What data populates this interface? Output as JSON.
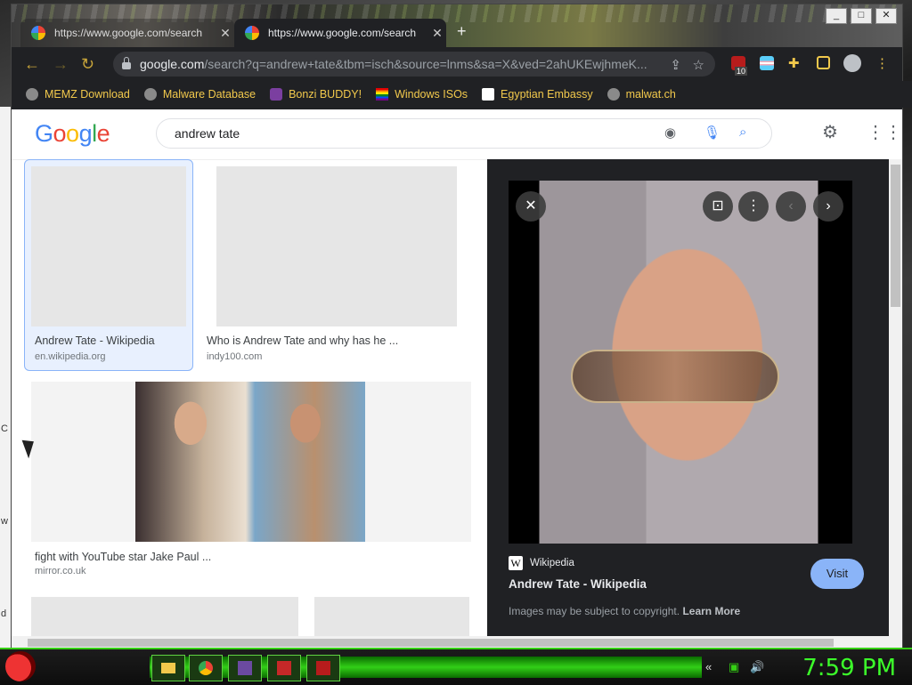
{
  "browser": {
    "tabs": [
      {
        "title": "https://www.google.com/search",
        "active": false
      },
      {
        "title": "https://www.google.com/search",
        "active": true
      }
    ],
    "new_tab": "+",
    "window_controls": [
      "_",
      "□",
      "✕"
    ],
    "url_domain": "google.com",
    "url_path": "/search?q=andrew+tate&tbm=isch&source=lnms&sa=X&ved=2ahUKEwjhmeK...",
    "extension_badge": "10"
  },
  "bookmarks": [
    {
      "label": "MEMZ Download"
    },
    {
      "label": "Malware Database"
    },
    {
      "label": "Bonzi BUDDY!"
    },
    {
      "label": "Windows ISOs"
    },
    {
      "label": "Egyptian Embassy"
    },
    {
      "label": "malwat.ch"
    }
  ],
  "google": {
    "logo_letters": [
      "G",
      "o",
      "o",
      "g",
      "l",
      "e"
    ],
    "logo_colors": [
      "#4285f4",
      "#ea4335",
      "#fbbc05",
      "#4285f4",
      "#34a853",
      "#ea4335"
    ],
    "query": "andrew tate"
  },
  "results": [
    {
      "caption": "Andrew Tate - Wikipedia",
      "source": "en.wikipedia.org"
    },
    {
      "caption": "Who is Andrew Tate and why has he ...",
      "source": "indy100.com"
    },
    {
      "caption": "fight with YouTube star Jake Paul ...",
      "source": "mirror.co.uk"
    },
    {
      "caption": "",
      "source": ""
    },
    {
      "caption": "",
      "source": ""
    }
  ],
  "preview": {
    "site_badge": "W",
    "site": "Wikipedia",
    "title": "Andrew Tate - Wikipedia",
    "visit_label": "Visit",
    "copyright_text": "Images may be subject to copyright.",
    "learn_more": "Learn More"
  },
  "taskbar": {
    "clock": "7:59 PM"
  },
  "desktop_letters": [
    "C",
    "w",
    "d"
  ]
}
